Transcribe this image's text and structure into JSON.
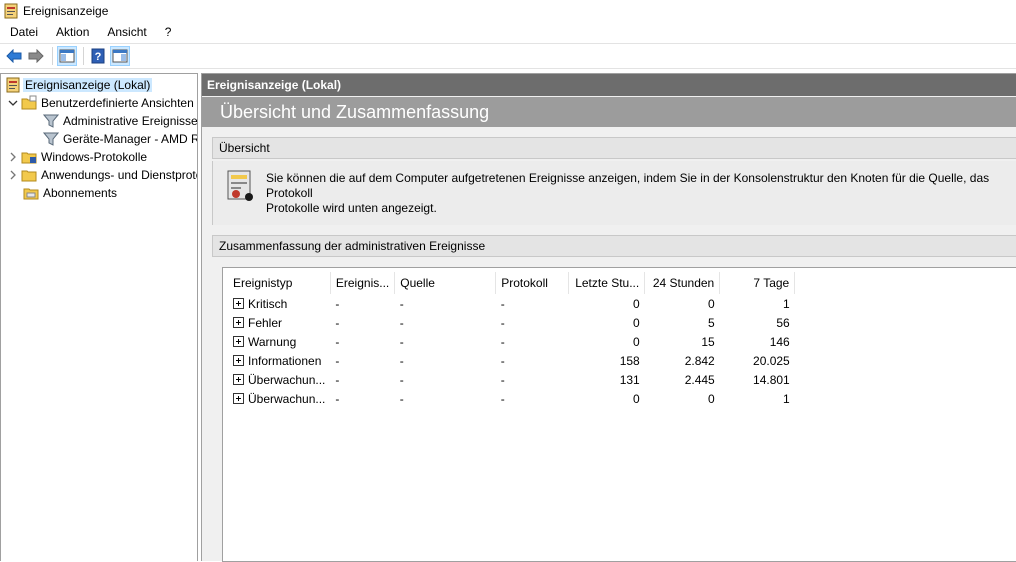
{
  "window": {
    "title": "Ereignisanzeige"
  },
  "menu": [
    "Datei",
    "Aktion",
    "Ansicht",
    "?"
  ],
  "toolbar": {
    "icons": [
      "back-arrow-icon",
      "forward-arrow-icon",
      "show-hide-tree-icon",
      "help-icon",
      "show-action-pane-icon"
    ]
  },
  "tree": {
    "items": [
      {
        "label": "Ereignisanzeige (Lokal)",
        "expander": "",
        "icon": "event-viewer-icon",
        "selected": true
      },
      {
        "label": "Benutzerdefinierte Ansichten",
        "expander": "expanded",
        "icon": "folder-icon"
      },
      {
        "label": "Administrative Ereignisse",
        "expander": "",
        "icon": "filter-icon"
      },
      {
        "label": "Geräte-Manager - AMD R",
        "expander": "",
        "icon": "filter-icon"
      },
      {
        "label": "Windows-Protokolle",
        "expander": "collapsed",
        "icon": "folder-icon"
      },
      {
        "label": "Anwendungs- und Dienstprotokolle",
        "expander": "collapsed",
        "icon": "folder-icon"
      },
      {
        "label": "Abonnements",
        "expander": "",
        "icon": "subscriptions-icon"
      }
    ]
  },
  "main": {
    "header": "Ereignisanzeige (Lokal)",
    "section_title": "Übersicht und Zusammenfassung",
    "overview": {
      "header": "Übersicht",
      "text": "Sie können die auf dem Computer aufgetretenen Ereignisse anzeigen, indem Sie in der Konsolenstruktur den Knoten für die Quelle, das Protokoll\nProtokolle wird unten angezeigt."
    },
    "summary": {
      "header": "Zusammenfassung der administrativen Ereignisse",
      "columns": [
        "Ereignistyp",
        "Ereignis...",
        "Quelle",
        "Protokoll",
        "Letzte Stu...",
        "24 Stunden",
        "7 Tage"
      ],
      "rows": [
        [
          "Kritisch",
          "-",
          "-",
          "-",
          "0",
          "0",
          "1"
        ],
        [
          "Fehler",
          "-",
          "-",
          "-",
          "0",
          "5",
          "56"
        ],
        [
          "Warnung",
          "-",
          "-",
          "-",
          "0",
          "15",
          "146"
        ],
        [
          "Informationen",
          "-",
          "-",
          "-",
          "158",
          "2.842",
          "20.025"
        ],
        [
          "Überwachun...",
          "-",
          "-",
          "-",
          "131",
          "2.445",
          "14.801"
        ],
        [
          "Überwachun...",
          "-",
          "-",
          "-",
          "0",
          "0",
          "1"
        ]
      ]
    }
  }
}
